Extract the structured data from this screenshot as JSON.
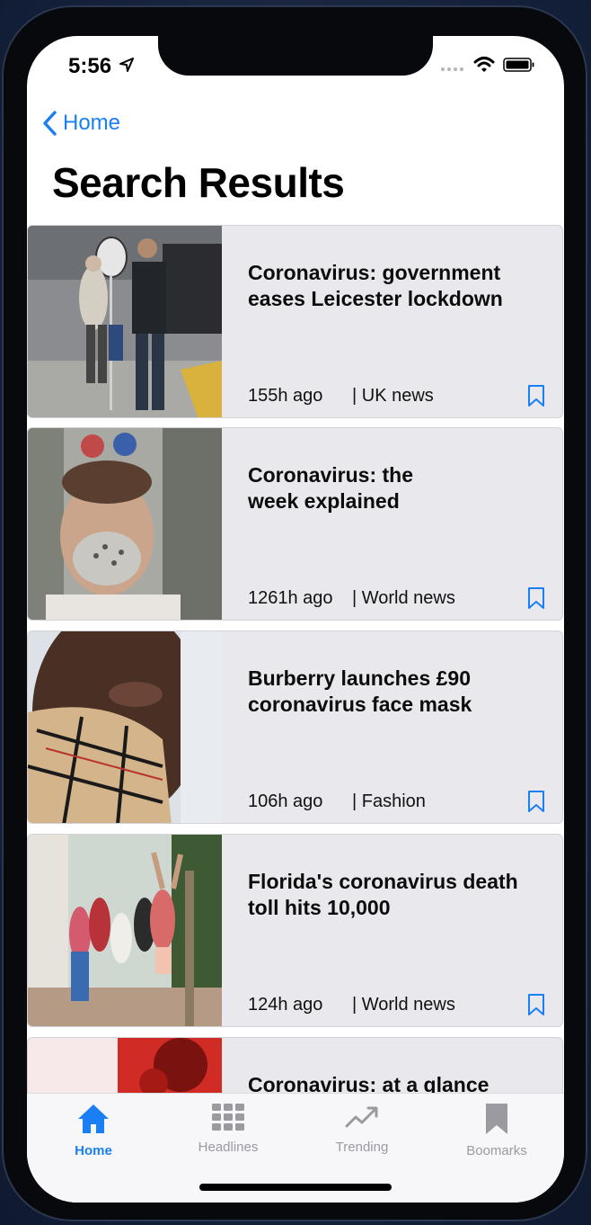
{
  "status_bar": {
    "time": "5:56",
    "icons": [
      "location-arrow-icon",
      "signal-icon",
      "wifi-icon",
      "battery-icon"
    ]
  },
  "nav": {
    "back_label": "Home",
    "title": "Search Results"
  },
  "articles": [
    {
      "headline": "Coronavirus: government eases Leicester lockdown",
      "time_ago": "155h ago",
      "section": "| UK news",
      "bookmark_icon": "bookmark-icon"
    },
    {
      "headline": "Coronavirus: the week explained",
      "time_ago": "1261h ago",
      "section": "| World news",
      "bookmark_icon": "bookmark-icon"
    },
    {
      "headline": "Burberry launches £90 coronavirus face mask",
      "time_ago": "106h ago",
      "section": "| Fashion",
      "bookmark_icon": "bookmark-icon"
    },
    {
      "headline": "Florida's coronavirus death toll hits 10,000",
      "time_ago": "124h ago",
      "section": "| World news",
      "bookmark_icon": "bookmark-icon"
    },
    {
      "headline": "Coronavirus: at a glance",
      "time_ago": "",
      "section": "",
      "bookmark_icon": "bookmark-icon"
    }
  ],
  "tab_bar": {
    "tabs": [
      {
        "label": "Home",
        "icon": "house-icon",
        "active": true
      },
      {
        "label": "Headlines",
        "icon": "grid-icon",
        "active": false
      },
      {
        "label": "Trending",
        "icon": "trending-icon",
        "active": false
      },
      {
        "label": "Boomarks",
        "icon": "bookmark-icon",
        "active": false
      }
    ]
  },
  "colors": {
    "accent": "#1a7ff5",
    "card_background": "#e9e9ed",
    "inactive_tab": "#9a9aa0"
  }
}
